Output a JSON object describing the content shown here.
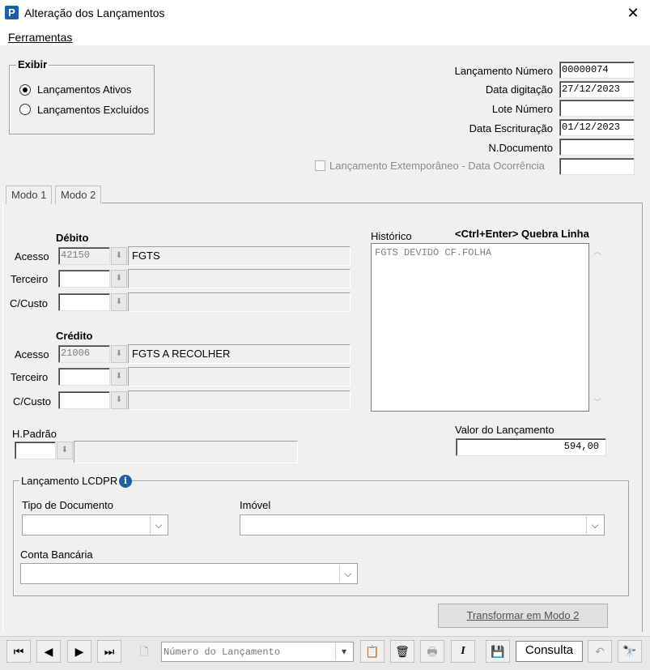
{
  "window": {
    "title": "Alteração dos Lançamentos",
    "close_glyph": "✕",
    "app_icon_letter": "P"
  },
  "menu": {
    "ferramentas": "Ferramentas"
  },
  "exibir": {
    "title": "Exibir",
    "options": [
      "Lançamentos Ativos",
      "Lançamentos Excluídos"
    ],
    "selected": 0
  },
  "header_fields": {
    "lancamento_numero": {
      "label": "Lançamento Número",
      "value": "00000074"
    },
    "data_digitacao": {
      "label": "Data digitação",
      "value": "27/12/2023"
    },
    "lote_numero": {
      "label": "Lote Número",
      "value": ""
    },
    "data_escrituracao": {
      "label": "Data Escrituração",
      "value": "01/12/2023"
    },
    "n_documento": {
      "label": "N.Documento",
      "value": ""
    },
    "extemporaneo": {
      "label": "Lançamento Extemporâneo - Data Ocorrência",
      "checked": false,
      "value": ""
    }
  },
  "tabs": [
    "Modo 1",
    "Modo 2"
  ],
  "debito": {
    "title": "Débito",
    "acesso": {
      "label": "Acesso",
      "code": "42150",
      "desc": "FGTS"
    },
    "terceiro": {
      "label": "Terceiro",
      "code": "",
      "desc": ""
    },
    "custo": {
      "label": "C/Custo",
      "code": "",
      "desc": ""
    }
  },
  "credito": {
    "title": "Crédito",
    "acesso": {
      "label": "Acesso",
      "code": "21006",
      "desc": "FGTS A RECOLHER"
    },
    "terceiro": {
      "label": "Terceiro",
      "code": "",
      "desc": ""
    },
    "custo": {
      "label": "C/Custo",
      "code": "",
      "desc": ""
    }
  },
  "historico": {
    "label": "Histórico",
    "hint": "<Ctrl+Enter> Quebra Linha",
    "text": "FGTS DEVIDO CF.FOLHA"
  },
  "h_padrao": {
    "label": "H.Padrão",
    "code": "",
    "desc": ""
  },
  "valor": {
    "label": "Valor do Lançamento",
    "value": "594,00"
  },
  "lcdpr": {
    "title": "Lançamento LCDPR",
    "tipo_documento": {
      "label": "Tipo de Documento",
      "value": ""
    },
    "imovel": {
      "label": "Imóvel",
      "value": ""
    },
    "conta_bancaria": {
      "label": "Conta Bancária",
      "value": ""
    }
  },
  "transformar_button": "Transformar em Modo 2",
  "toolbar": {
    "search_placeholder": "Número do Lançamento",
    "mode_label": "Consulta",
    "icons": [
      "first-record-icon",
      "prev-record-icon",
      "next-record-icon",
      "last-record-icon",
      "new-document-icon",
      "search-dropdown",
      "export-icon",
      "delete-icon",
      "print-icon",
      "italic-icon",
      "save-icon",
      "undo-icon",
      "binoculars-icon"
    ]
  },
  "colors": {
    "accent": "#1f5fa8",
    "window_bg": "#f0f0f0",
    "field_border": "#7a7a7a"
  }
}
